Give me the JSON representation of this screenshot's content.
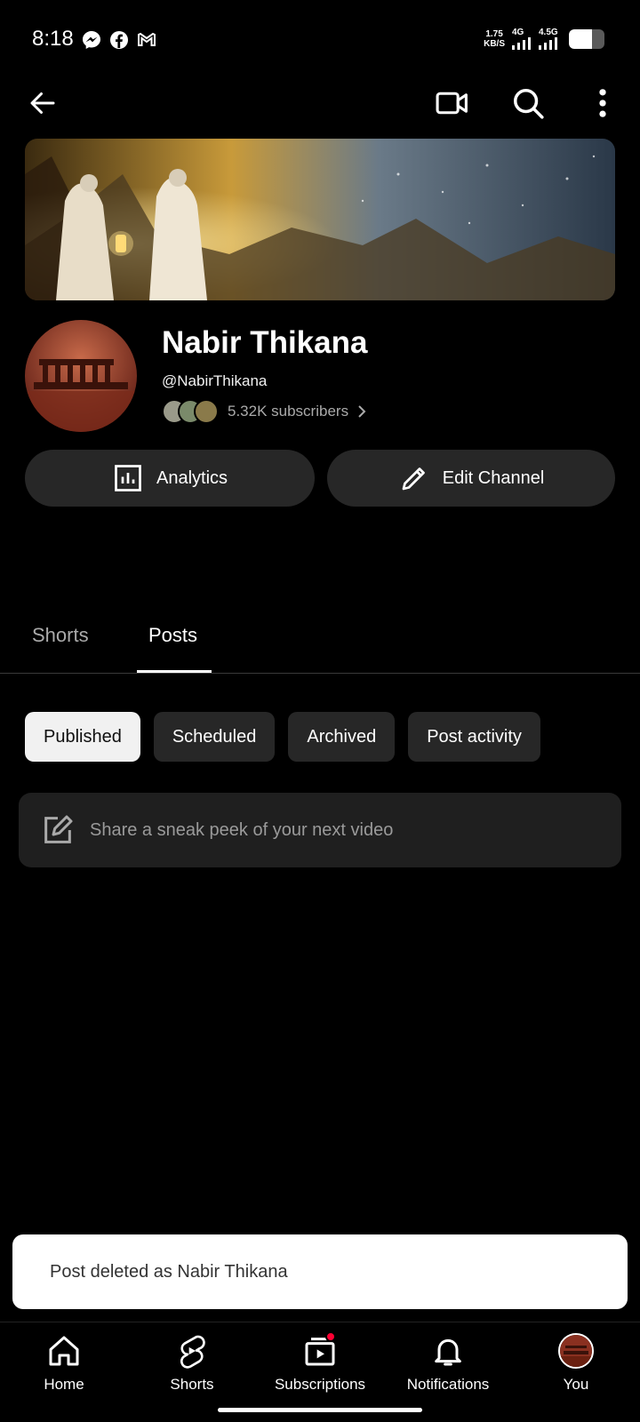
{
  "status_bar": {
    "time": "8:18",
    "net_speed_value": "1.75",
    "net_speed_unit": "KB/S",
    "signal1_label": "4G",
    "signal2_label": "4.5G",
    "app_icons": [
      "messenger-icon",
      "facebook-icon",
      "gmail-icon"
    ]
  },
  "top_bar": {
    "icons": [
      "back-arrow-icon",
      "video-camera-icon",
      "search-icon",
      "more-vert-icon"
    ]
  },
  "channel": {
    "name": "Nabir Thikana",
    "handle": "@NabirThikana",
    "subscribers": "5.32K subscribers"
  },
  "actions": {
    "analytics_label": "Analytics",
    "edit_label": "Edit Channel"
  },
  "tabs": [
    {
      "label": "Shorts",
      "selected": false
    },
    {
      "label": "Posts",
      "selected": true
    }
  ],
  "filter_chips": [
    {
      "label": "Published",
      "selected": true
    },
    {
      "label": "Scheduled",
      "selected": false
    },
    {
      "label": "Archived",
      "selected": false
    },
    {
      "label": "Post activity",
      "selected": false
    }
  ],
  "composer": {
    "placeholder": "Share a sneak peek of your next video"
  },
  "snackbar": {
    "message": "Post deleted as Nabir Thikana"
  },
  "bottom_nav": [
    {
      "label": "Home",
      "icon": "home-icon"
    },
    {
      "label": "Shorts",
      "icon": "shorts-icon"
    },
    {
      "label": "Subscriptions",
      "icon": "subscriptions-icon"
    },
    {
      "label": "Notifications",
      "icon": "bell-icon"
    },
    {
      "label": "You",
      "icon": "avatar"
    }
  ],
  "colors": {
    "background": "#000000",
    "surface": "#272727",
    "chip_selected": "#f1f1f1",
    "accent_red": "#ff0033"
  }
}
